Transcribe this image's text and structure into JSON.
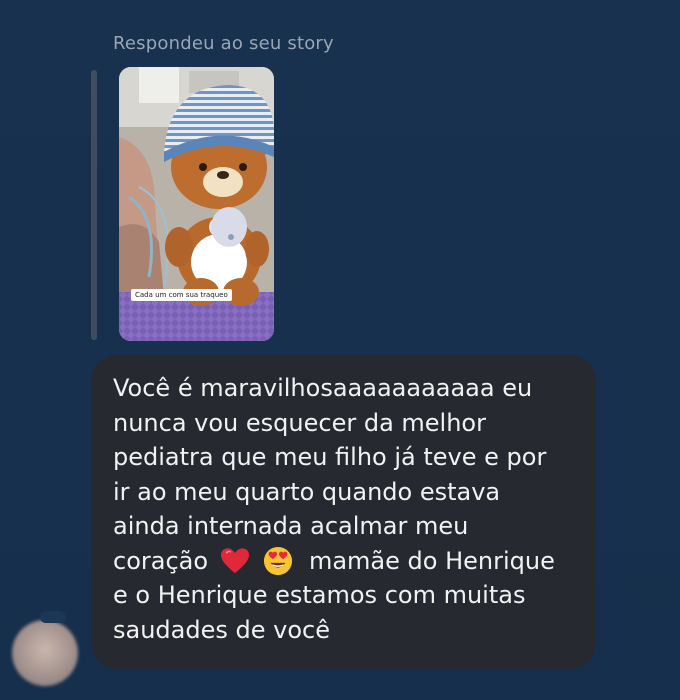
{
  "reply": {
    "caption": "Respondeu ao seu story"
  },
  "story": {
    "caption": "Cada um com sua traqueo",
    "image": "teddy-bear-in-knit-hat-photo"
  },
  "message": {
    "lines": [
      "Você é maravilhosaaaaaaaaaaa eu",
      "nunca vou esquecer da melhor",
      "pediatra que meu filho já teve e por",
      "ir ao meu quarto quando estava",
      "ainda internada acalmar meu",
      "coração",
      "mamãe do Henrique",
      "e o Henrique estamos com muitas",
      "saudades de você"
    ],
    "emojis": [
      "red-heart-icon",
      "heart-eyes-face-icon"
    ]
  },
  "sender": {
    "avatar": "avatar-blurred"
  },
  "colors": {
    "background": "#17314f",
    "bubble": "#262a30",
    "text": "#f2f2f2",
    "caption": "#9aa6b4"
  }
}
